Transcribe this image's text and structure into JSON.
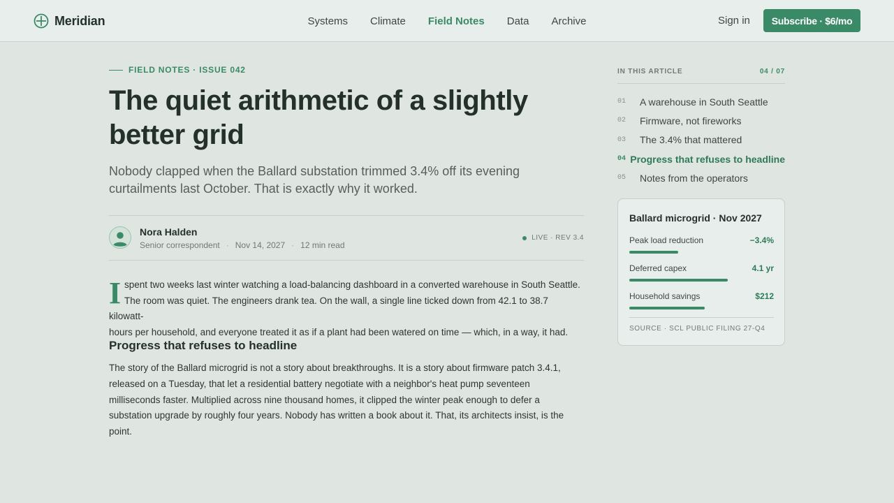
{
  "brand": {
    "name": "Meridian",
    "icon": "compass-icon"
  },
  "nav": {
    "items": [
      {
        "label": "Systems",
        "active": false
      },
      {
        "label": "Climate",
        "active": false
      },
      {
        "label": "Field Notes",
        "active": true
      },
      {
        "label": "Data",
        "active": false
      },
      {
        "label": "Archive",
        "active": false
      }
    ],
    "sign_in": "Sign in",
    "subscribe": "Subscribe · $6/mo"
  },
  "article": {
    "kicker": "FIELD NOTES · ISSUE 042",
    "headline_lines": [
      "The quiet arithmetic of a slightly",
      "better grid"
    ],
    "dek_lines": [
      "Nobody clapped when the Ballard substation trimmed 3.4% off its evening",
      "curtailments last October. That is exactly why it worked."
    ],
    "author": "Nora Halden",
    "role": "Senior correspondent",
    "date": "Nov 14, 2027",
    "read_time": "12 min read",
    "status": "LIVE · REV 3.4",
    "dropcap": "I",
    "para1_lines": [
      "spent two weeks last winter watching a load-balancing dashboard in a converted warehouse in South Seattle.",
      "The room was quiet. The engineers drank tea. On the wall, a single line ticked down from 42.1 to 38.7 kilowatt-",
      "hours per household, and everyone treated it as if a plant had been watered on time — which, in a way, it had."
    ],
    "section_heading": "Progress that refuses to headline",
    "para2_lines": [
      "The story of the Ballard microgrid is not a story about breakthroughs. It is a story about firmware patch 3.4.1,",
      "released on a Tuesday, that let a residential battery negotiate with a neighbor's heat pump seventeen",
      "milliseconds faster. Multiplied across nine thousand homes, it clipped the winter peak enough to defer a",
      "substation upgrade by roughly four years. Nobody has written a book about it. That, its architects insist, is the",
      "point."
    ]
  },
  "toc": {
    "heading": "IN THIS ARTICLE",
    "progress": "04 / 07",
    "items": [
      {
        "num": "01",
        "label": "A warehouse in South Seattle",
        "active": false
      },
      {
        "num": "02",
        "label": "Firmware, not fireworks",
        "active": false
      },
      {
        "num": "03",
        "label": "The 3.4% that mattered",
        "active": false
      },
      {
        "num": "04",
        "label": "Progress that refuses to headline",
        "active": true
      },
      {
        "num": "05",
        "label": "Notes from the operators",
        "active": false
      }
    ]
  },
  "card": {
    "title": "Ballard microgrid · Nov 2027",
    "stats": [
      {
        "label": "Peak load reduction",
        "value": "−3.4%",
        "level": 0.34
      },
      {
        "label": "Deferred capex",
        "value": "4.1 yr",
        "level": 0.68
      },
      {
        "label": "Household savings",
        "value": "$212",
        "level": 0.52
      }
    ],
    "source": "SOURCE · SCL PUBLIC FILING 27-Q4"
  },
  "colors": {
    "accent": "#3a8a67",
    "background": "#dfe5e1",
    "text": "#24302b"
  }
}
